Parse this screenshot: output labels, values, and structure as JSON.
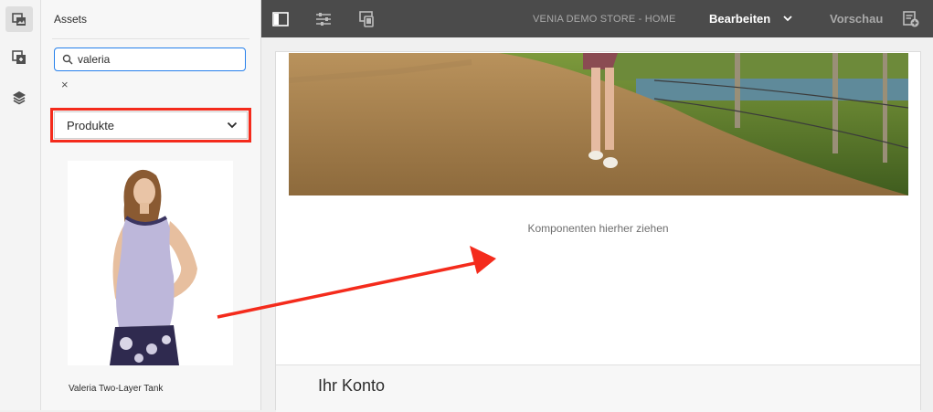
{
  "side_rail": {
    "items": [
      {
        "icon": "assets-icon",
        "active": true
      },
      {
        "icon": "components-icon",
        "active": false
      },
      {
        "icon": "content-tree-icon",
        "active": false
      }
    ]
  },
  "assets_panel": {
    "title": "Assets",
    "search": {
      "value": "valeria"
    },
    "clear_label": "×",
    "asset_type": {
      "selected": "Produkte"
    },
    "results": [
      {
        "name": "Valeria Two-Layer Tank"
      }
    ]
  },
  "toolbar": {
    "page_title": "VENIA DEMO STORE - HOME",
    "mode_label": "Bearbeiten",
    "preview_label": "Vorschau"
  },
  "page": {
    "drop_zone_text": "Komponenten hierher ziehen",
    "account_heading": "Ihr Konto"
  },
  "colors": {
    "highlight": "#f42b1c",
    "toolbar_bg": "#4b4b4b",
    "search_focus": "#2680eb"
  }
}
